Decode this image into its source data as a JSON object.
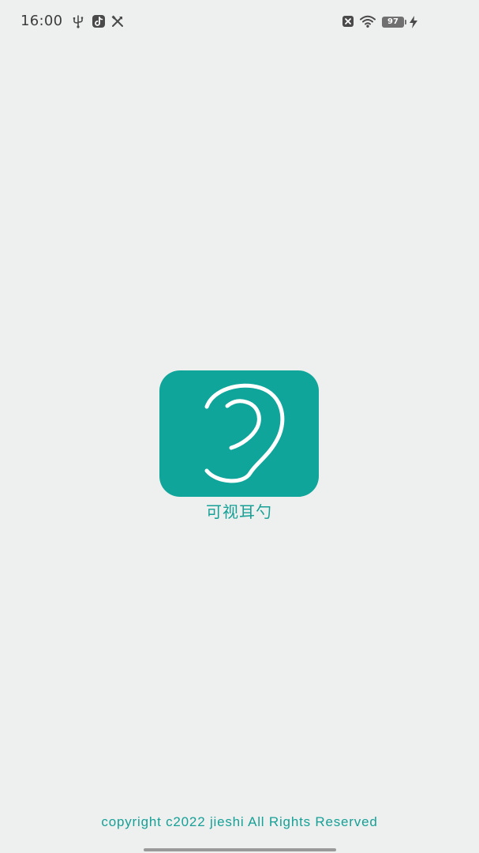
{
  "status_bar": {
    "time": "16:00",
    "left_icons": [
      "usb-icon",
      "tiktok-icon",
      "tools-icon"
    ],
    "right_icons": [
      "no-sim-icon",
      "wifi-icon",
      "battery-icon",
      "charging-bolt-icon"
    ],
    "battery_level": "97"
  },
  "splash": {
    "logo_icon": "ear-icon",
    "logo_color": "#0fa59a",
    "app_name": "可视耳勺",
    "copyright": "copyright c2022 jieshi All Rights Reserved",
    "accent_color": "#16a096"
  }
}
